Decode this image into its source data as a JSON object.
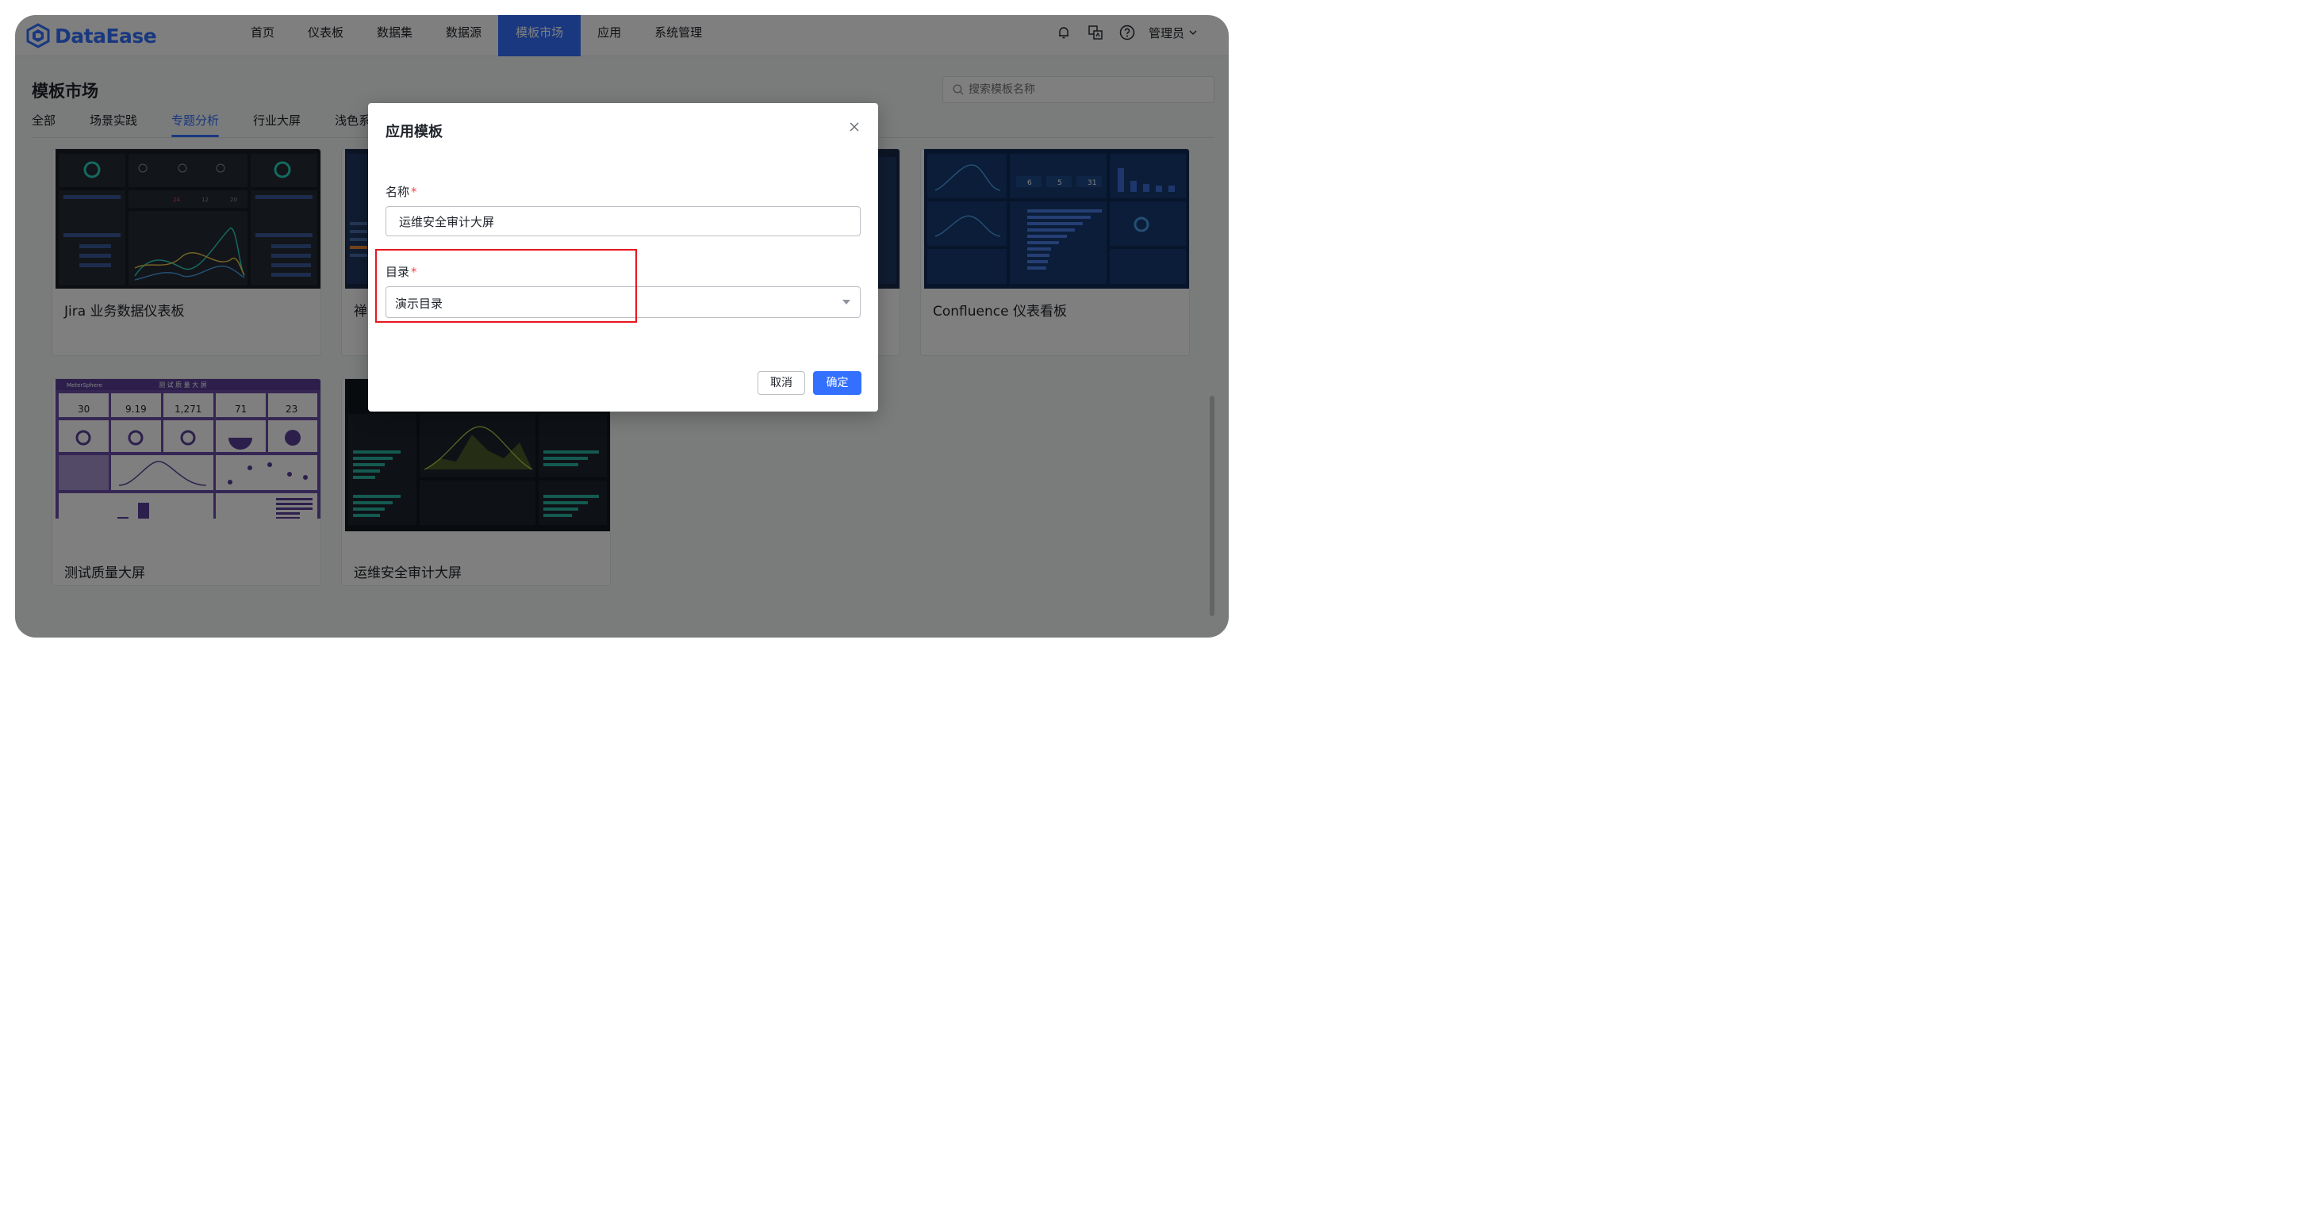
{
  "brand": {
    "name": "DataEase",
    "accent": "#3370ff"
  },
  "nav": {
    "items": [
      {
        "label": "首页"
      },
      {
        "label": "仪表板"
      },
      {
        "label": "数据集"
      },
      {
        "label": "数据源"
      },
      {
        "label": "模板市场",
        "active": true
      },
      {
        "label": "应用"
      },
      {
        "label": "系统管理"
      }
    ]
  },
  "user": {
    "name": "管理员"
  },
  "page": {
    "title": "模板市场",
    "search_placeholder": "搜索模板名称",
    "tabs": [
      {
        "label": "全部"
      },
      {
        "label": "场景实践"
      },
      {
        "label": "专题分析",
        "active": true
      },
      {
        "label": "行业大屏"
      },
      {
        "label": "浅色系"
      }
    ]
  },
  "cards": [
    {
      "name": "Jira 业务数据仪表板"
    },
    {
      "name": "禅"
    },
    {
      "name": ""
    },
    {
      "name": "Confluence 仪表看板"
    },
    {
      "name": "测试质量大屏"
    },
    {
      "name": "运维安全审计大屏"
    }
  ],
  "thumb_text": {
    "ms_brand": "MeterSphere",
    "ms_title": "测 试 质 量 大 屏",
    "ms_stats": [
      "30",
      "9.19",
      "1,271",
      "71",
      "23"
    ],
    "conf_stats": [
      "6",
      "5",
      "31"
    ],
    "jira_stats": [
      "24",
      "12",
      "20"
    ]
  },
  "dialog": {
    "title": "应用模板",
    "name_label": "名称",
    "name_value": "运维安全审计大屏",
    "dir_label": "目录",
    "dir_value": "演示目录",
    "required_mark": "*",
    "cancel_label": "取消",
    "ok_label": "确定",
    "highlight_color": "#e8181f"
  }
}
